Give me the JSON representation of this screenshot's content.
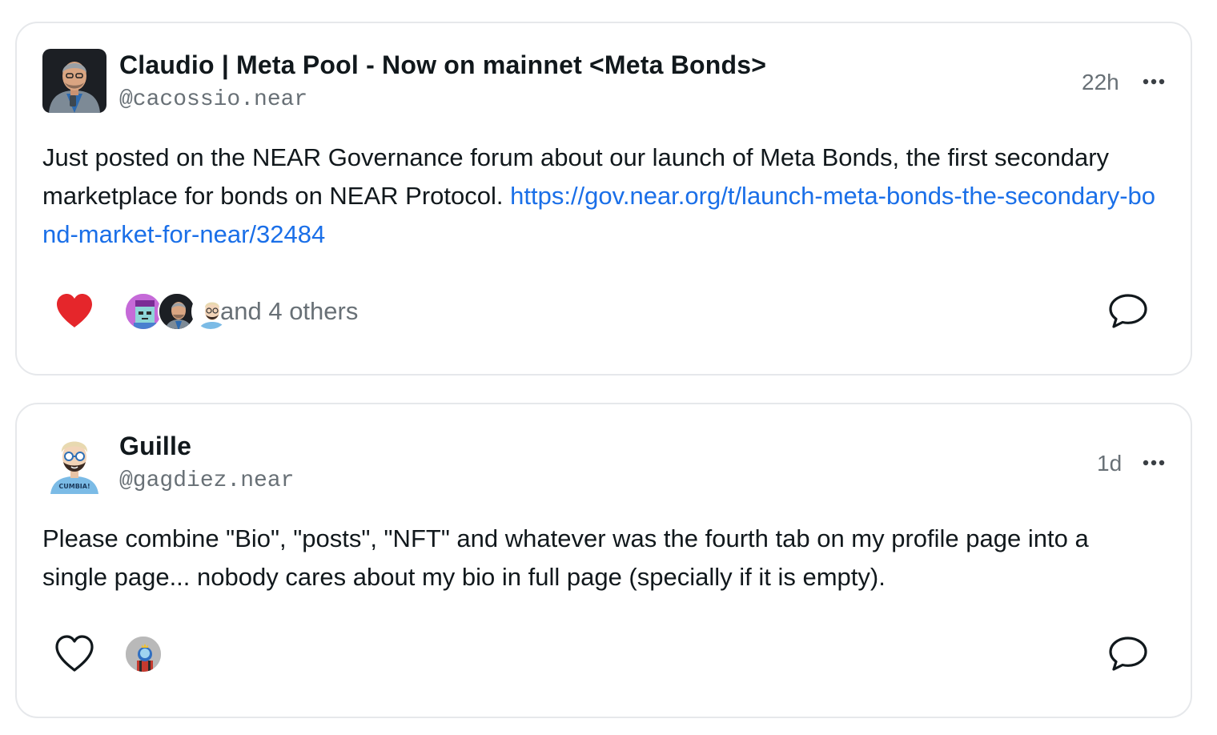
{
  "posts": [
    {
      "author": "Claudio | Meta Pool - Now on mainnet <Meta Bonds>",
      "handle": "@cacossio.near",
      "time": "22h",
      "text": "Just posted on the NEAR Governance forum about our launch of Meta Bonds, the first secondary marketplace for bonds on NEAR Protocol. ",
      "link": "https://gov.near.org/t/launch-meta-bonds-the-secondary-bond-market-for-near/32484",
      "liked": true,
      "likers_text": "and 4 others"
    },
    {
      "author": "Guille",
      "handle": "@gagdiez.near",
      "time": "1d",
      "text": "Please combine \"Bio\", \"posts\", \"NFT\" and whatever was the fourth tab on my profile page into a single page... nobody cares about my bio in full page (specially if it is empty).",
      "liked": false
    }
  ],
  "icons": {
    "like_filled": "heart-filled-icon",
    "like_empty": "heart-outline-icon",
    "comment": "comment-bubble-icon",
    "more": "more-dots-icon"
  },
  "colors": {
    "like": "#e5262b",
    "link": "#1a6fe8",
    "muted": "#687076",
    "border": "#e6e8eb"
  }
}
